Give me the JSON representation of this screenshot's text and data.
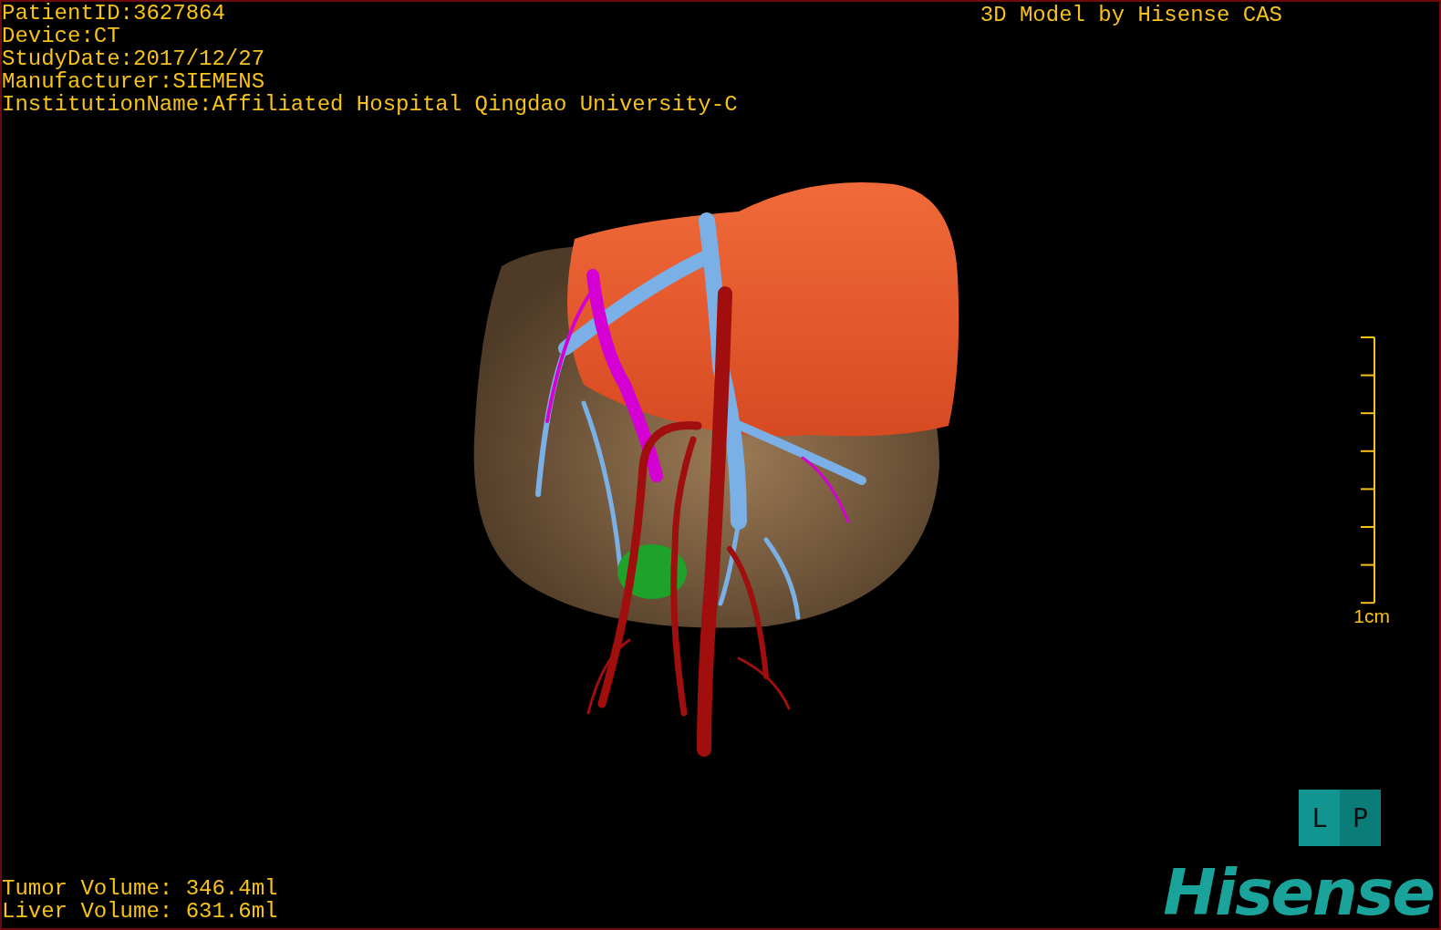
{
  "study_info": [
    "PatientID:3627864",
    "Device:CT",
    "StudyDate:2017/12/27",
    "Manufacturer:SIEMENS",
    "InstitutionName:Affiliated Hospital Qingdao University-C"
  ],
  "model_title": "3D Model by Hisense CAS",
  "scale_bar": {
    "label": "1cm"
  },
  "volumes": [
    "Tumor Volume: 346.4ml",
    "Liver Volume: 631.6ml"
  ],
  "orientation_cube": {
    "faces": [
      "L",
      "P"
    ]
  },
  "logo": "Hisense"
}
